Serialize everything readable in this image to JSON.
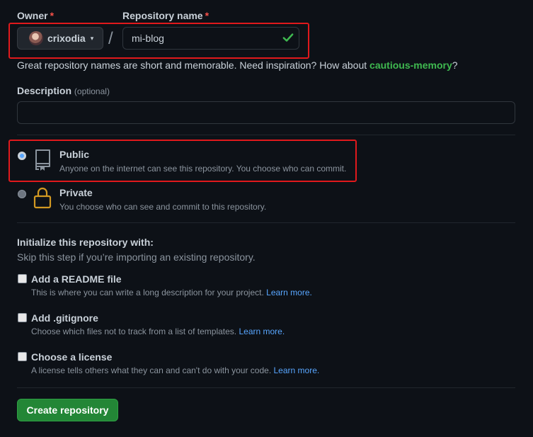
{
  "owner": {
    "label": "Owner",
    "required_mark": "*",
    "username": "crixodia",
    "caret": "▾",
    "avatar_icon": "user-avatar"
  },
  "repo_name": {
    "label": "Repository name",
    "required_mark": "*",
    "separator": "/",
    "value": "mi-blog",
    "status_icon": "check-icon"
  },
  "name_hint": {
    "text": "Great repository names are short and memorable. Need inspiration? How about ",
    "suggestion": "cautious-memory",
    "end": "?"
  },
  "description": {
    "label": "Description",
    "optional": "(optional)",
    "value": ""
  },
  "visibility": {
    "selected": "public",
    "public": {
      "title": "Public",
      "description": "Anyone on the internet can see this repository. You choose who can commit.",
      "icon": "repo-icon"
    },
    "private": {
      "title": "Private",
      "description": "You choose who can see and commit to this repository.",
      "icon": "lock-icon"
    }
  },
  "initialize": {
    "title": "Initialize this repository with:",
    "subtitle": "Skip this step if you’re importing an existing repository.",
    "options": [
      {
        "title": "Add a README file",
        "description": "This is where you can write a long description for your project. ",
        "link": "Learn more.",
        "checked": false
      },
      {
        "title": "Add .gitignore",
        "description": "Choose which files not to track from a list of templates. ",
        "link": "Learn more.",
        "checked": false
      },
      {
        "title": "Choose a license",
        "description": "A license tells others what they can and can't do with your code. ",
        "link": "Learn more.",
        "checked": false
      }
    ]
  },
  "submit": {
    "label": "Create repository"
  },
  "colors": {
    "background": "#0d1117",
    "highlight": "#e0191c",
    "success": "#3fb950",
    "link": "#58a6ff",
    "button": "#238636"
  }
}
